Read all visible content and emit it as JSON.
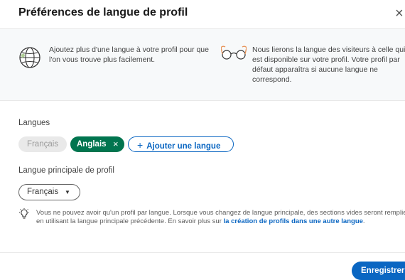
{
  "dialog": {
    "title": "Préférences de langue de profil",
    "close_icon": "×"
  },
  "info": {
    "globe_icon": "globe-icon",
    "glasses_icon": "glasses-icon",
    "text1": "Ajoutez plus d'une langue à votre profil pour que l'on vous trouve plus facilement.",
    "text2": "Nous lierons la langue des visiteurs à celle qui est disponible sur votre profil. Votre profil par défaut apparaîtra si aucune langue ne correspond."
  },
  "languages": {
    "label": "Langues",
    "items": [
      {
        "label": "Français",
        "state": "disabled"
      },
      {
        "label": "Anglais",
        "state": "selected",
        "remove_icon": "×"
      }
    ],
    "add_button": {
      "icon": "+",
      "label": "Ajouter une langue"
    }
  },
  "primary": {
    "label": "Langue principale de profil",
    "selected": "Français",
    "caret": "▼"
  },
  "note": {
    "icon": "lightbulb-icon",
    "text": "Vous ne pouvez avoir qu'un profil par langue. Lorsque vous changez de langue principale, des sections vides seront remplies en utilisant la langue principale précédente. En savoir plus sur ",
    "link": "la création de profils dans une autre langue",
    "end": "."
  },
  "footer": {
    "save_label": "Enregistrer"
  },
  "colors": {
    "brand_blue": "#0a66c2",
    "selected_green": "#01754f",
    "info_band_bg": "#f7f9fa"
  }
}
